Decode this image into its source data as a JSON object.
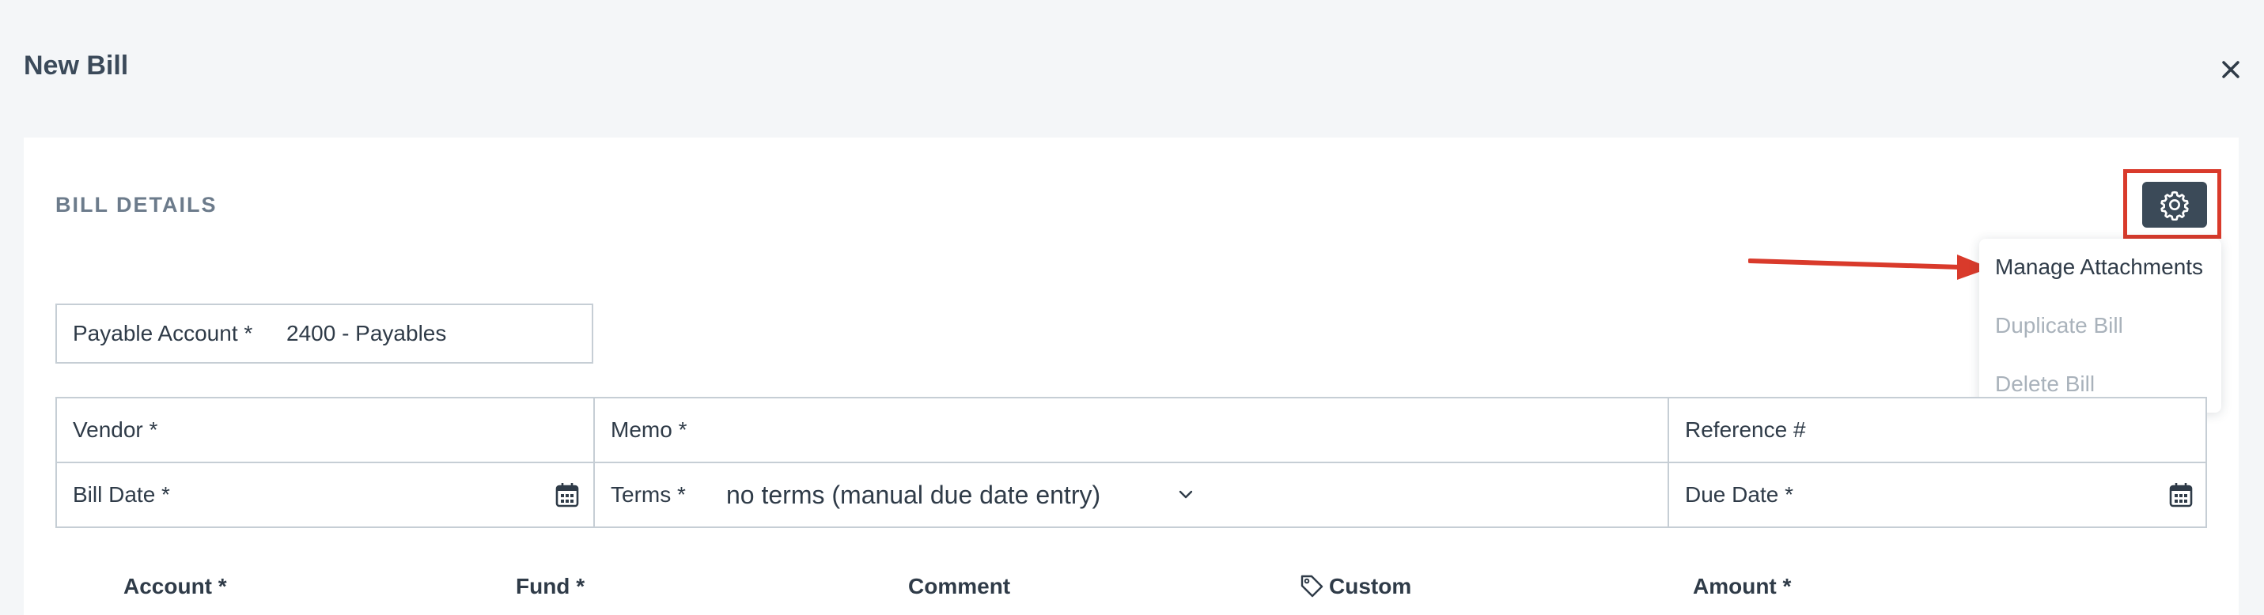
{
  "modal": {
    "title": "New Bill"
  },
  "section": {
    "title": "BILL DETAILS"
  },
  "menu": {
    "items": [
      {
        "label": "Manage Attachments",
        "state": "enabled"
      },
      {
        "label": "Duplicate Bill",
        "state": "disabled"
      },
      {
        "label": "Delete Bill",
        "state": "disabled"
      }
    ]
  },
  "fields": {
    "payable_account": {
      "label": "Payable Account *",
      "value": "2400 - Payables"
    },
    "vendor": {
      "label": "Vendor *"
    },
    "memo": {
      "label": "Memo *"
    },
    "reference": {
      "label": "Reference #"
    },
    "bill_date": {
      "label": "Bill Date *"
    },
    "terms": {
      "label": "Terms *",
      "value": "no terms (manual due date entry)"
    },
    "due_date": {
      "label": "Due Date *"
    }
  },
  "line_items": {
    "columns": [
      "Account *",
      "Fund *",
      "Comment",
      "Custom",
      "Amount *"
    ]
  },
  "colors": {
    "highlight": "#d93a2b",
    "gear_button": "#3b4a58",
    "border": "#c6ced5",
    "disabled_text": "#a9b2bb"
  },
  "icons": [
    "close-icon",
    "gear-icon",
    "calendar-icon",
    "chevron-down-icon",
    "tag-icon"
  ]
}
